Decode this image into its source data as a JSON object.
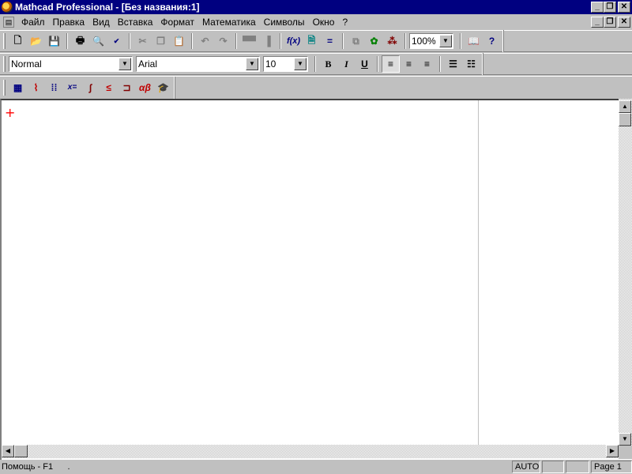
{
  "window": {
    "title": "Mathcad Professional - [Без названия:1]",
    "minimize_icon": "minimize-icon",
    "restore_icon": "restore-icon",
    "close_icon": "close-icon"
  },
  "menu": {
    "items": [
      {
        "label": "Файл"
      },
      {
        "label": "Правка"
      },
      {
        "label": "Вид"
      },
      {
        "label": "Вставка"
      },
      {
        "label": "Формат"
      },
      {
        "label": "Математика"
      },
      {
        "label": "Символы"
      },
      {
        "label": "Окно"
      },
      {
        "label": "?"
      }
    ]
  },
  "format_toolbar": {
    "style": "Normal",
    "font": "Arial",
    "size": "10",
    "bold": "B",
    "italic": "I",
    "underline": "U"
  },
  "standard_toolbar": {
    "zoom": "100%"
  },
  "worksheet": {
    "cursor": "+"
  },
  "status": {
    "help": "Помощь - F1",
    "dot": ".",
    "calc_mode": "AUTO",
    "panel2": "",
    "panel3": "",
    "page": "Page 1"
  },
  "colors": {
    "titlebar": "#000080",
    "cursor": "#ff0000"
  }
}
